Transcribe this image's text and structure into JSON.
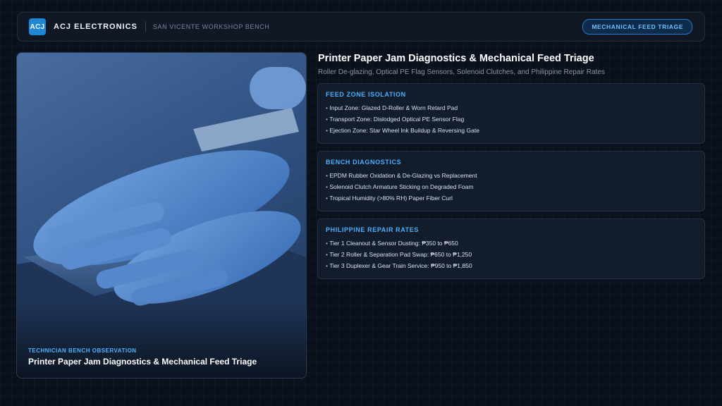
{
  "header": {
    "logo_text": "ACJ",
    "brand": "ACJ ELECTRONICS",
    "location": "SAN VICENTE WORKSHOP BENCH",
    "badge": "MECHANICAL FEED TRIAGE"
  },
  "photo": {
    "caption_label": "TECHNICIAN BENCH OBSERVATION",
    "caption_title": "Printer Paper Jam Diagnostics & Mechanical Feed Triage"
  },
  "main": {
    "title": "Printer Paper Jam Diagnostics & Mechanical Feed Triage",
    "subtitle": "Roller De-glazing, Optical PE Flag Sensors, Solenoid Clutches, and Philippine Repair Rates"
  },
  "cards": [
    {
      "heading": "FEED ZONE ISOLATION",
      "items": [
        "Input Zone: Glazed D-Roller & Worn Retard Pad",
        "Transport Zone: Dislodged Optical PE Sensor Flag",
        "Ejection Zone: Star Wheel Ink Buildup & Reversing Gate"
      ]
    },
    {
      "heading": "BENCH DIAGNOSTICS",
      "items": [
        "EPDM Rubber Oxidation & De-Glazing vs Replacement",
        "Solenoid Clutch Armature Sticking on Degraded Foam",
        "Tropical Humidity (>80% RH) Paper Fiber Curl"
      ]
    },
    {
      "heading": "PHILIPPINE REPAIR RATES",
      "items": [
        "Tier 1 Cleanout & Sensor Dusting: ₱350 to ₱650",
        "Tier 2 Roller & Separation Pad Swap: ₱650 to ₱1,250",
        "Tier 3 Duplexer & Gear Train Service: ₱950 to ₱1,850"
      ]
    }
  ],
  "colors": {
    "background": "#0b111c",
    "accent": "#49b1ff",
    "badge_border": "#2b79c4"
  }
}
